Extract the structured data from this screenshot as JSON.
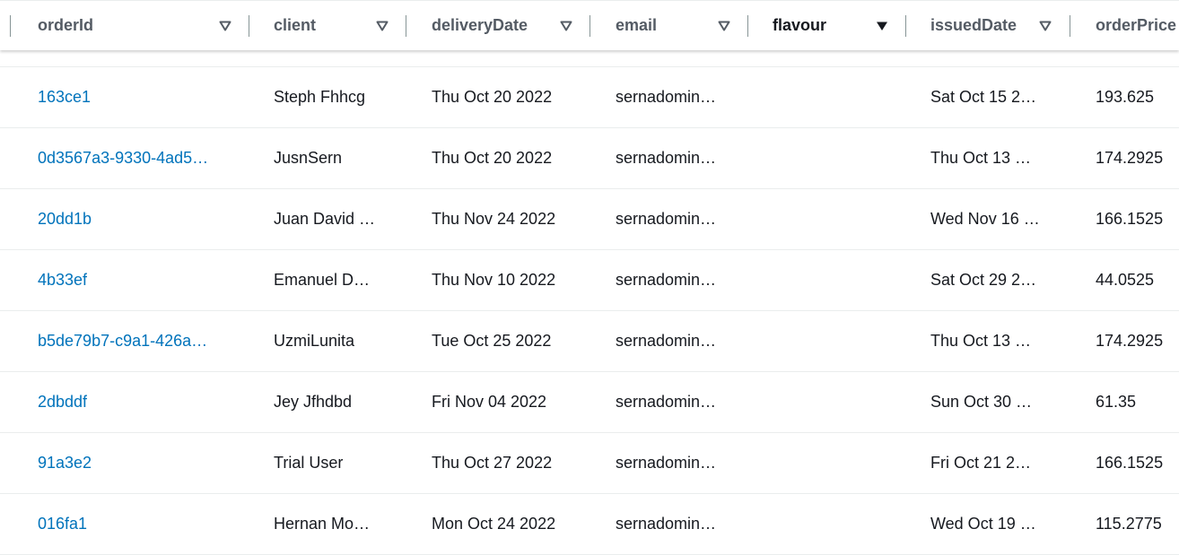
{
  "columns": [
    {
      "key": "orderId",
      "label": "orderId",
      "sort_icon": "sort-down-outline-icon"
    },
    {
      "key": "client",
      "label": "client",
      "sort_icon": "sort-down-outline-icon"
    },
    {
      "key": "deliveryDate",
      "label": "deliveryDate",
      "sort_icon": "sort-down-outline-icon"
    },
    {
      "key": "email",
      "label": "email",
      "sort_icon": "sort-down-outline-icon"
    },
    {
      "key": "flavour",
      "label": "flavour",
      "sort_icon": "sort-down-filled-icon"
    },
    {
      "key": "issuedDate",
      "label": "issuedDate",
      "sort_icon": "sort-down-outline-icon"
    },
    {
      "key": "orderPrice",
      "label": "orderPrice"
    }
  ],
  "rows": [
    {
      "orderId": "163ce1",
      "client": "Steph Fhhcg",
      "deliveryDate": "Thu Oct 20 2022",
      "email": "sernadomin…",
      "flavour": "",
      "issuedDate": "Sat Oct 15 2…",
      "orderPrice": "193.625"
    },
    {
      "orderId": "0d3567a3-9330-4ad5…",
      "client": "JusnSern",
      "deliveryDate": "Thu Oct 20 2022",
      "email": "sernadomin…",
      "flavour": "",
      "issuedDate": "Thu Oct 13 …",
      "orderPrice": "174.2925"
    },
    {
      "orderId": "20dd1b",
      "client": "Juan David …",
      "deliveryDate": "Thu Nov 24 2022",
      "email": "sernadomin…",
      "flavour": "",
      "issuedDate": "Wed Nov 16 …",
      "orderPrice": "166.1525"
    },
    {
      "orderId": "4b33ef",
      "client": "Emanuel D…",
      "deliveryDate": "Thu Nov 10 2022",
      "email": "sernadomin…",
      "flavour": "",
      "issuedDate": "Sat Oct 29 2…",
      "orderPrice": "44.0525"
    },
    {
      "orderId": "b5de79b7-c9a1-426a…",
      "client": "UzmiLunita",
      "deliveryDate": "Tue Oct 25 2022",
      "email": "sernadomin…",
      "flavour": "",
      "issuedDate": "Thu Oct 13 …",
      "orderPrice": "174.2925"
    },
    {
      "orderId": "2dbddf",
      "client": "Jey Jfhdbd",
      "deliveryDate": "Fri Nov 04 2022",
      "email": "sernadomin…",
      "flavour": "",
      "issuedDate": "Sun Oct 30 …",
      "orderPrice": "61.35"
    },
    {
      "orderId": "91a3e2",
      "client": "Trial User",
      "deliveryDate": "Thu Oct 27 2022",
      "email": "sernadomin…",
      "flavour": "",
      "issuedDate": "Fri Oct 21 2…",
      "orderPrice": "166.1525"
    },
    {
      "orderId": "016fa1",
      "client": "Hernan Mo…",
      "deliveryDate": "Mon Oct 24 2022",
      "email": "sernadomin…",
      "flavour": "",
      "issuedDate": "Wed Oct 19 …",
      "orderPrice": "115.2775"
    }
  ],
  "colors": {
    "link": "#0073bb",
    "text": "#16191f",
    "header_text": "#545b64",
    "divider": "#eaeded",
    "separator": "#879596"
  }
}
